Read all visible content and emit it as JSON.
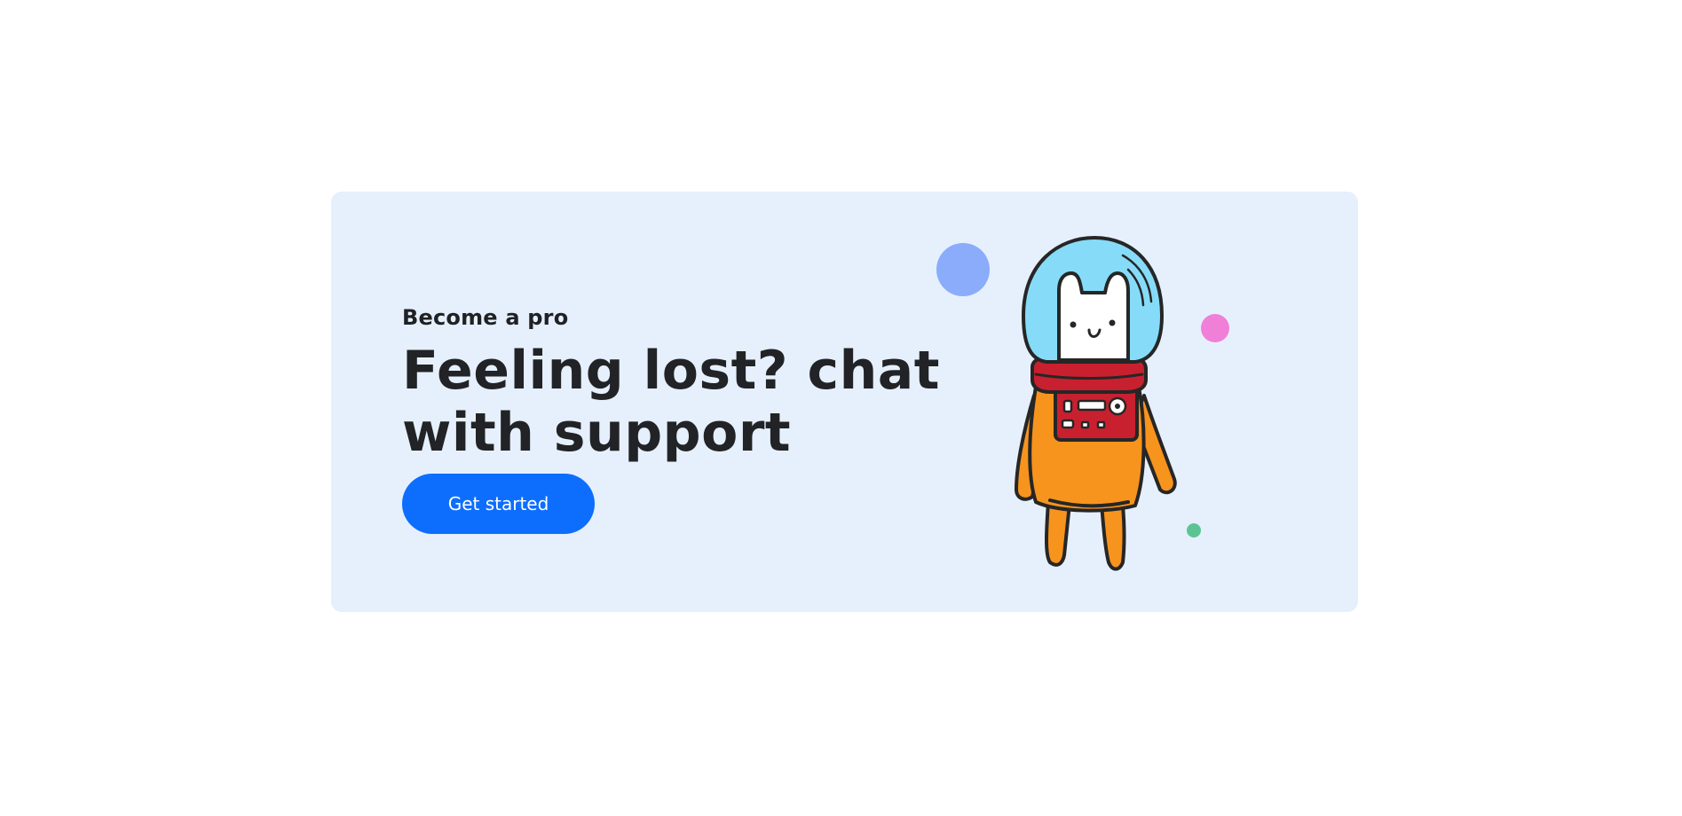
{
  "banner": {
    "eyebrow": "Become a pro",
    "headline_line1": "Feeling lost? chat",
    "headline_line2": "with support",
    "cta_label": "Get started"
  },
  "colors": {
    "card_background": "#e6f0fd",
    "cta_background": "#0d6efd",
    "headline_text": "#222326",
    "bubble_blue": "#8aacfb",
    "bubble_pink": "#f07fd8",
    "bubble_green": "#5cc494",
    "helmet": "#86dcf8",
    "suit": "#f7941d",
    "collar": "#c8202f"
  },
  "illustration": {
    "icon": "astronaut-cat-illustration"
  }
}
